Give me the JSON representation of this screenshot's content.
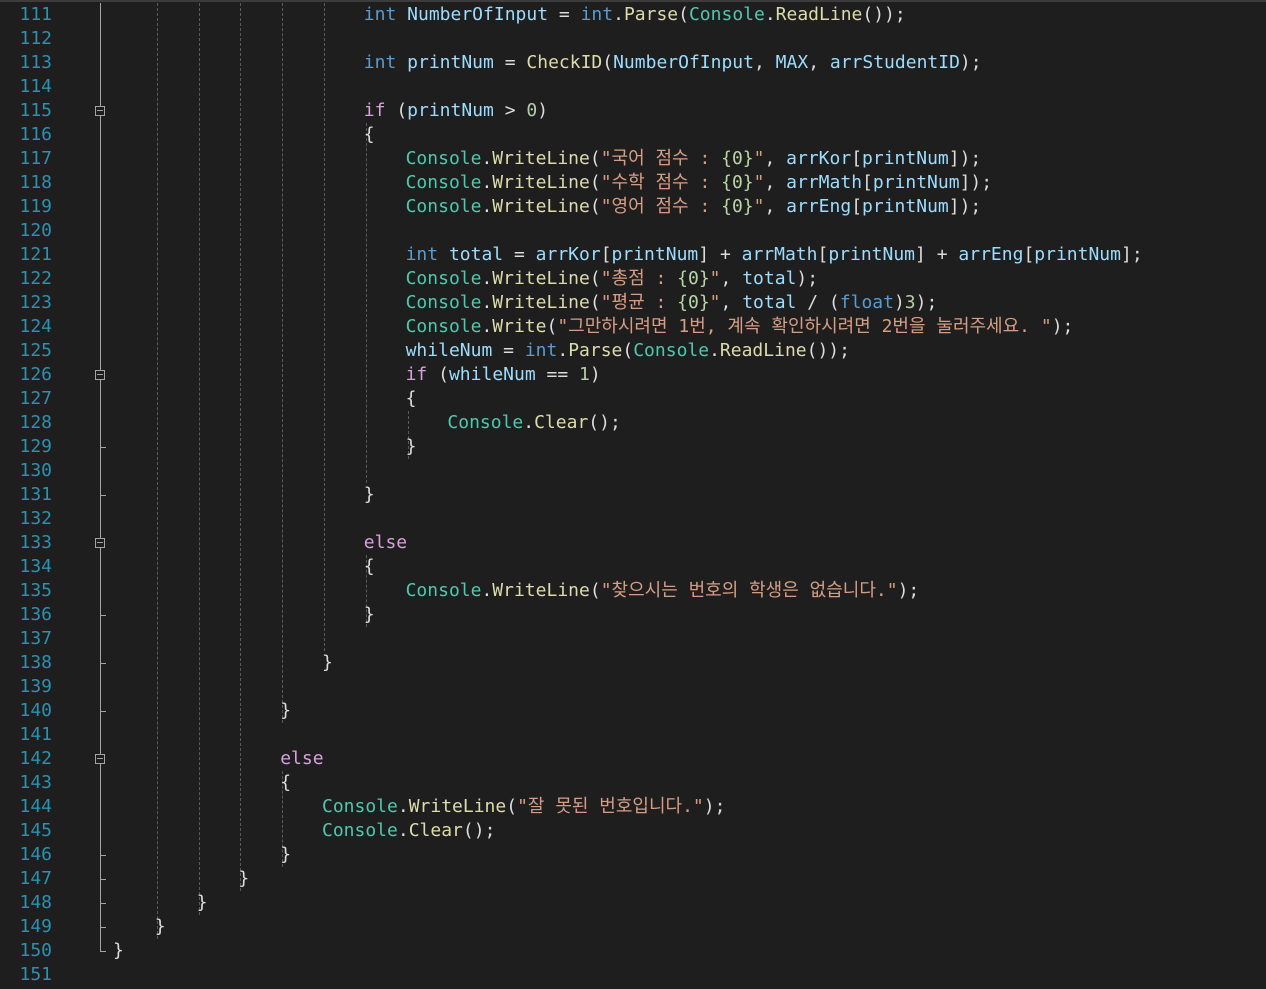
{
  "editor": {
    "colors": {
      "background": "#1e1e1e",
      "line_number": "#2b91af",
      "keyword": "#569cd6",
      "control": "#d8a0df",
      "class": "#4ec9b0",
      "method": "#dcdcaa",
      "string": "#d69d85",
      "variable": "#9cdcfe"
    },
    "lines": [
      {
        "n": "111",
        "text": "int NumberOfInput = int.Parse(Console.ReadLine());"
      },
      {
        "n": "112",
        "text": ""
      },
      {
        "n": "113",
        "text": "int printNum = CheckID(NumberOfInput, MAX, arrStudentID);"
      },
      {
        "n": "114",
        "text": ""
      },
      {
        "n": "115",
        "text": "if (printNum > 0)"
      },
      {
        "n": "116",
        "text": "{"
      },
      {
        "n": "117",
        "text": "Console.WriteLine(\"국어 점수 : {0}\", arrKor[printNum]);"
      },
      {
        "n": "118",
        "text": "Console.WriteLine(\"수학 점수 : {0}\", arrMath[printNum]);"
      },
      {
        "n": "119",
        "text": "Console.WriteLine(\"영어 점수 : {0}\", arrEng[printNum]);"
      },
      {
        "n": "120",
        "text": ""
      },
      {
        "n": "121",
        "text": "int total = arrKor[printNum] + arrMath[printNum] + arrEng[printNum];"
      },
      {
        "n": "122",
        "text": "Console.WriteLine(\"총점 : {0}\", total);"
      },
      {
        "n": "123",
        "text": "Console.WriteLine(\"평균 : {0}\", total / (float)3);"
      },
      {
        "n": "124",
        "text": "Console.Write(\"그만하시려면 1번, 계속 확인하시려면 2번을 눌러주세요. \");"
      },
      {
        "n": "125",
        "text": "whileNum = int.Parse(Console.ReadLine());"
      },
      {
        "n": "126",
        "text": "if (whileNum == 1)"
      },
      {
        "n": "127",
        "text": "{"
      },
      {
        "n": "128",
        "text": "Console.Clear();"
      },
      {
        "n": "129",
        "text": "}"
      },
      {
        "n": "130",
        "text": ""
      },
      {
        "n": "131",
        "text": "}"
      },
      {
        "n": "132",
        "text": ""
      },
      {
        "n": "133",
        "text": "else"
      },
      {
        "n": "134",
        "text": "{"
      },
      {
        "n": "135",
        "text": "Console.WriteLine(\"찾으시는 번호의 학생은 없습니다.\");"
      },
      {
        "n": "136",
        "text": "}"
      },
      {
        "n": "137",
        "text": ""
      },
      {
        "n": "138",
        "text": "}"
      },
      {
        "n": "139",
        "text": ""
      },
      {
        "n": "140",
        "text": "}"
      },
      {
        "n": "141",
        "text": ""
      },
      {
        "n": "142",
        "text": "else"
      },
      {
        "n": "143",
        "text": "{"
      },
      {
        "n": "144",
        "text": "Console.WriteLine(\"잘 못된 번호입니다.\");"
      },
      {
        "n": "145",
        "text": "Console.Clear();"
      },
      {
        "n": "146",
        "text": "}"
      },
      {
        "n": "147",
        "text": "}"
      },
      {
        "n": "148",
        "text": "}"
      },
      {
        "n": "149",
        "text": "}"
      },
      {
        "n": "150",
        "text": "}"
      },
      {
        "n": "151",
        "text": ""
      }
    ]
  }
}
